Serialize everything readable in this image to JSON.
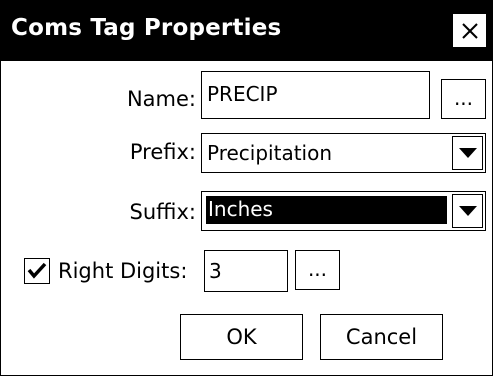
{
  "dialog": {
    "title": "Coms Tag Properties",
    "close_icon": "close-x-icon"
  },
  "name": {
    "label": "Name:",
    "value": "PRECIP",
    "browse_label": "..."
  },
  "prefix": {
    "label": "Prefix:",
    "selected": "Precipitation",
    "dropdown_icon": "triangle-down-icon"
  },
  "suffix": {
    "label": "Suffix:",
    "selected": "Inches",
    "dropdown_icon": "triangle-down-icon"
  },
  "right_digits": {
    "label": "Right Digits:",
    "checked": true,
    "value": "3",
    "browse_label": "..."
  },
  "buttons": {
    "ok": "OK",
    "cancel": "Cancel"
  }
}
